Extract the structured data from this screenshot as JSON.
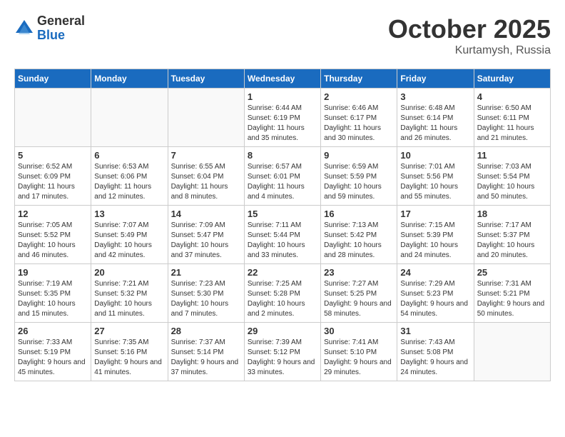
{
  "logo": {
    "general": "General",
    "blue": "Blue"
  },
  "title": "October 2025",
  "location": "Kurtamysh, Russia",
  "days_of_week": [
    "Sunday",
    "Monday",
    "Tuesday",
    "Wednesday",
    "Thursday",
    "Friday",
    "Saturday"
  ],
  "weeks": [
    [
      {
        "day": "",
        "info": ""
      },
      {
        "day": "",
        "info": ""
      },
      {
        "day": "",
        "info": ""
      },
      {
        "day": "1",
        "info": "Sunrise: 6:44 AM\nSunset: 6:19 PM\nDaylight: 11 hours and 35 minutes."
      },
      {
        "day": "2",
        "info": "Sunrise: 6:46 AM\nSunset: 6:17 PM\nDaylight: 11 hours and 30 minutes."
      },
      {
        "day": "3",
        "info": "Sunrise: 6:48 AM\nSunset: 6:14 PM\nDaylight: 11 hours and 26 minutes."
      },
      {
        "day": "4",
        "info": "Sunrise: 6:50 AM\nSunset: 6:11 PM\nDaylight: 11 hours and 21 minutes."
      }
    ],
    [
      {
        "day": "5",
        "info": "Sunrise: 6:52 AM\nSunset: 6:09 PM\nDaylight: 11 hours and 17 minutes."
      },
      {
        "day": "6",
        "info": "Sunrise: 6:53 AM\nSunset: 6:06 PM\nDaylight: 11 hours and 12 minutes."
      },
      {
        "day": "7",
        "info": "Sunrise: 6:55 AM\nSunset: 6:04 PM\nDaylight: 11 hours and 8 minutes."
      },
      {
        "day": "8",
        "info": "Sunrise: 6:57 AM\nSunset: 6:01 PM\nDaylight: 11 hours and 4 minutes."
      },
      {
        "day": "9",
        "info": "Sunrise: 6:59 AM\nSunset: 5:59 PM\nDaylight: 10 hours and 59 minutes."
      },
      {
        "day": "10",
        "info": "Sunrise: 7:01 AM\nSunset: 5:56 PM\nDaylight: 10 hours and 55 minutes."
      },
      {
        "day": "11",
        "info": "Sunrise: 7:03 AM\nSunset: 5:54 PM\nDaylight: 10 hours and 50 minutes."
      }
    ],
    [
      {
        "day": "12",
        "info": "Sunrise: 7:05 AM\nSunset: 5:52 PM\nDaylight: 10 hours and 46 minutes."
      },
      {
        "day": "13",
        "info": "Sunrise: 7:07 AM\nSunset: 5:49 PM\nDaylight: 10 hours and 42 minutes."
      },
      {
        "day": "14",
        "info": "Sunrise: 7:09 AM\nSunset: 5:47 PM\nDaylight: 10 hours and 37 minutes."
      },
      {
        "day": "15",
        "info": "Sunrise: 7:11 AM\nSunset: 5:44 PM\nDaylight: 10 hours and 33 minutes."
      },
      {
        "day": "16",
        "info": "Sunrise: 7:13 AM\nSunset: 5:42 PM\nDaylight: 10 hours and 28 minutes."
      },
      {
        "day": "17",
        "info": "Sunrise: 7:15 AM\nSunset: 5:39 PM\nDaylight: 10 hours and 24 minutes."
      },
      {
        "day": "18",
        "info": "Sunrise: 7:17 AM\nSunset: 5:37 PM\nDaylight: 10 hours and 20 minutes."
      }
    ],
    [
      {
        "day": "19",
        "info": "Sunrise: 7:19 AM\nSunset: 5:35 PM\nDaylight: 10 hours and 15 minutes."
      },
      {
        "day": "20",
        "info": "Sunrise: 7:21 AM\nSunset: 5:32 PM\nDaylight: 10 hours and 11 minutes."
      },
      {
        "day": "21",
        "info": "Sunrise: 7:23 AM\nSunset: 5:30 PM\nDaylight: 10 hours and 7 minutes."
      },
      {
        "day": "22",
        "info": "Sunrise: 7:25 AM\nSunset: 5:28 PM\nDaylight: 10 hours and 2 minutes."
      },
      {
        "day": "23",
        "info": "Sunrise: 7:27 AM\nSunset: 5:25 PM\nDaylight: 9 hours and 58 minutes."
      },
      {
        "day": "24",
        "info": "Sunrise: 7:29 AM\nSunset: 5:23 PM\nDaylight: 9 hours and 54 minutes."
      },
      {
        "day": "25",
        "info": "Sunrise: 7:31 AM\nSunset: 5:21 PM\nDaylight: 9 hours and 50 minutes."
      }
    ],
    [
      {
        "day": "26",
        "info": "Sunrise: 7:33 AM\nSunset: 5:19 PM\nDaylight: 9 hours and 45 minutes."
      },
      {
        "day": "27",
        "info": "Sunrise: 7:35 AM\nSunset: 5:16 PM\nDaylight: 9 hours and 41 minutes."
      },
      {
        "day": "28",
        "info": "Sunrise: 7:37 AM\nSunset: 5:14 PM\nDaylight: 9 hours and 37 minutes."
      },
      {
        "day": "29",
        "info": "Sunrise: 7:39 AM\nSunset: 5:12 PM\nDaylight: 9 hours and 33 minutes."
      },
      {
        "day": "30",
        "info": "Sunrise: 7:41 AM\nSunset: 5:10 PM\nDaylight: 9 hours and 29 minutes."
      },
      {
        "day": "31",
        "info": "Sunrise: 7:43 AM\nSunset: 5:08 PM\nDaylight: 9 hours and 24 minutes."
      },
      {
        "day": "",
        "info": ""
      }
    ]
  ]
}
